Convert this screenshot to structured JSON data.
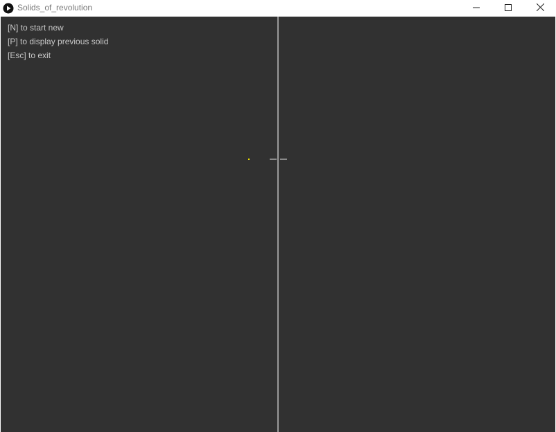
{
  "window": {
    "title": "Solids_of_revolution",
    "icon": "processing-app-icon",
    "controls": {
      "minimize_icon": "minimize-icon",
      "maximize_icon": "maximize-icon",
      "close_icon": "close-icon"
    }
  },
  "canvas": {
    "background_color": "#313131",
    "instructions": [
      "[N] to start new",
      "[P] to display previous solid",
      "[Esc] to exit"
    ],
    "point_color": "#f5e400",
    "axis_color": "#9a9a9a"
  }
}
